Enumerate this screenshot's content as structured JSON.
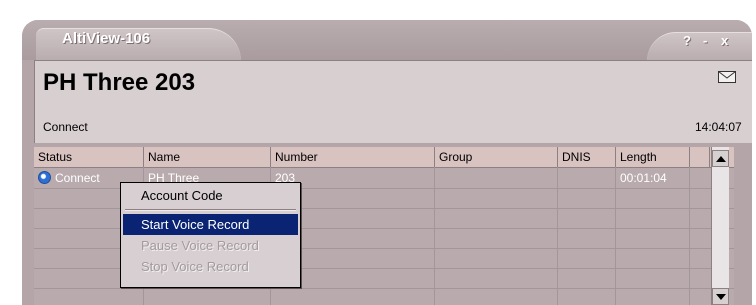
{
  "window": {
    "title": "AltiView-106",
    "help_label": "?",
    "minimize_label": "-",
    "close_label": "x"
  },
  "header": {
    "contact_name": "PH Three  203",
    "state": "Connect",
    "clock": "14:04:07",
    "mail_icon": "mail-icon"
  },
  "table": {
    "columns": [
      "Status",
      "Name",
      "Number",
      "Group",
      "DNIS",
      "Length"
    ],
    "rows": [
      {
        "status": "Connect",
        "name": "PH Three",
        "number": "203",
        "group": "",
        "dnis": "",
        "length": "00:01:04"
      }
    ]
  },
  "context_menu": {
    "items": [
      {
        "label": "Account Code",
        "state": "enabled"
      },
      {
        "label": "Start Voice Record",
        "state": "selected"
      },
      {
        "label": "Pause Voice Record",
        "state": "disabled"
      },
      {
        "label": "Stop Voice Record",
        "state": "disabled"
      }
    ]
  }
}
